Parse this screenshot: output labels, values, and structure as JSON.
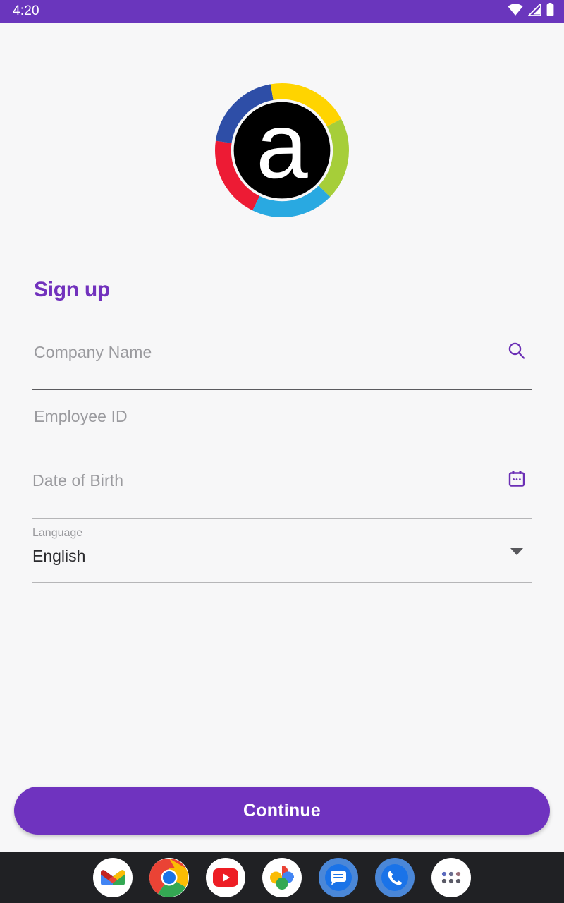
{
  "status_bar": {
    "time": "4:20",
    "background": "#6a36bd",
    "icons": [
      "wifi-icon",
      "signal-icon",
      "battery-icon"
    ]
  },
  "logo": {
    "letter": "a",
    "inner_color": "#000000",
    "ring_segments": [
      {
        "name": "red",
        "color": "#ed1b34"
      },
      {
        "name": "blue",
        "color": "#2e4ea7"
      },
      {
        "name": "yellow",
        "color": "#ffd400"
      },
      {
        "name": "green",
        "color": "#a6ce39"
      },
      {
        "name": "cyan",
        "color": "#29a9e1"
      }
    ]
  },
  "form": {
    "title": "Sign up",
    "accent_color": "#7232bd",
    "fields": [
      {
        "name": "company-name",
        "placeholder": "Company Name",
        "value": "",
        "trailing_icon": "search-icon",
        "focused": true
      },
      {
        "name": "employee-id",
        "placeholder": "Employee ID",
        "value": "",
        "trailing_icon": "",
        "focused": false
      },
      {
        "name": "date-of-birth",
        "placeholder": "Date of Birth",
        "value": "",
        "trailing_icon": "calendar-icon",
        "focused": false
      }
    ],
    "language_select": {
      "label": "Language",
      "value": "English",
      "trailing_icon": "chevron-down-icon"
    },
    "submit_label": "Continue",
    "submit_color": "#6f33bf"
  },
  "dock": {
    "background": "#202124",
    "apps": [
      {
        "name": "gmail",
        "label": "Gmail"
      },
      {
        "name": "chrome",
        "label": "Chrome"
      },
      {
        "name": "youtube",
        "label": "YouTube"
      },
      {
        "name": "photos",
        "label": "Photos"
      },
      {
        "name": "messages",
        "label": "Messages"
      },
      {
        "name": "phone",
        "label": "Phone"
      },
      {
        "name": "app-drawer",
        "label": "All apps"
      }
    ]
  }
}
